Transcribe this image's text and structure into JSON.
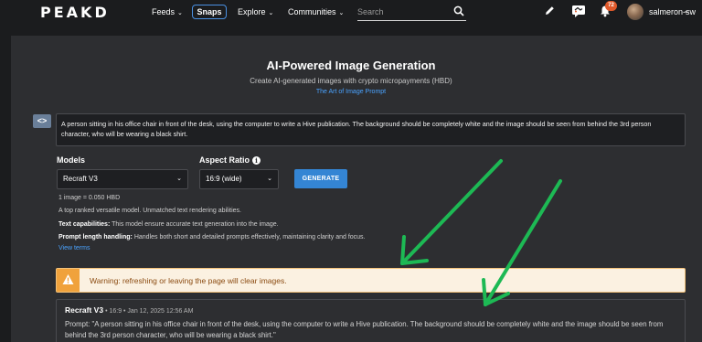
{
  "nav": {
    "logo": "PEAKD",
    "items": [
      {
        "label": "Feeds",
        "chevron": "⌄"
      },
      {
        "label": "Snaps"
      },
      {
        "label": "Explore",
        "chevron": "⌄"
      },
      {
        "label": "Communities",
        "chevron": "⌄"
      }
    ],
    "search_placeholder": "Search",
    "notification_count": "72",
    "username": "salmeron-sw",
    "icons": [
      "pencil-icon",
      "chat-icon",
      "bell-icon",
      "search-icon",
      "chevron-down-icon"
    ]
  },
  "header": {
    "title": "AI-Powered Image Generation",
    "subtitle": "Create AI-generated images with crypto micropayments (HBD)",
    "link": "The Art of Image Prompt"
  },
  "prompt": {
    "toggle_label": "<>",
    "text": "A person sitting in his office chair in front of the desk, using the computer to write a Hive publication. The background should be completely white and the image should be seen from behind the 3rd person character, who will be wearing a black shirt."
  },
  "controls": {
    "models_label": "Models",
    "model_value": "Recraft V3",
    "aspect_label": "Aspect Ratio",
    "aspect_value": "16:9 (wide)",
    "generate_label": "GENERATE"
  },
  "info": {
    "price": "1 image = 0.050 HBD",
    "description": "A top ranked versatile model. Unmatched text rendering abilities.",
    "text_cap_label": "Text capabilities:",
    "text_cap_value": " This model ensure accurate text generation into the image.",
    "prompt_len_label": "Prompt length handling:",
    "prompt_len_value": " Handles both short and detailed prompts effectively, maintaining clarity and focus.",
    "view_terms": "View terms"
  },
  "warning": {
    "text": "Warning: refreshing or leaving the page will clear images."
  },
  "result": {
    "model": "Recraft V3",
    "meta": "• 16:9 • Jan 12, 2025 12:56 AM",
    "prompt": "Prompt: \"A person sitting in his office chair in front of the desk, using the computer to write a Hive publication. The background should be completely white and the image should be seen from behind the 3rd person character, who will be wearing a black shirt.\""
  },
  "colors": {
    "background": "#1b1c1e",
    "panel": "#2d2e31",
    "accent": "#3485d4",
    "link": "#4aa3ff",
    "warning": "#f0a23c",
    "arrow": "#1db954"
  }
}
